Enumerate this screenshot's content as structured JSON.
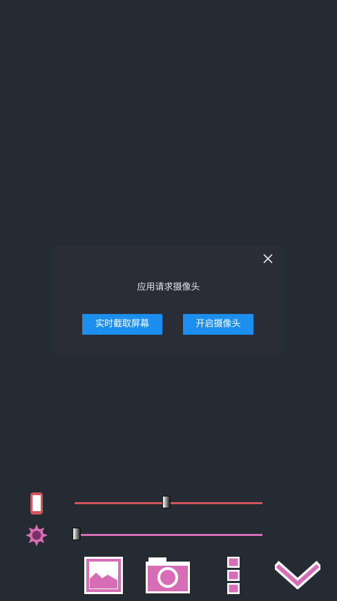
{
  "dialog": {
    "message": "应用请求摄像头",
    "screen_capture_button": "实时截取屏幕",
    "open_camera_button": "开启摄像头"
  },
  "controls": {
    "phone_slider_value": 0.49,
    "brightness_slider_value": 0.01
  },
  "colors": {
    "background": "#252b33",
    "dialog_background": "#2b2d36",
    "button_blue": "#1b8ef0",
    "accent_pink": "#d66db6",
    "accent_red": "#d2545c"
  },
  "icons": {
    "close": "close-icon",
    "phone": "phone-icon",
    "brightness": "brightness-icon",
    "gallery": "gallery-icon",
    "camera": "camera-icon",
    "more": "more-vertical-icon",
    "collapse": "chevron-down-icon"
  }
}
